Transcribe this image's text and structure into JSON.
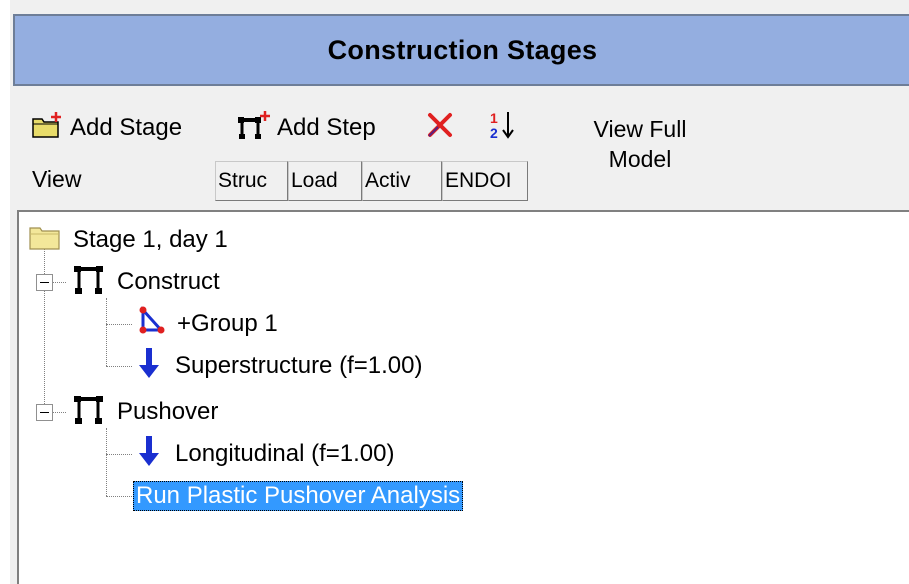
{
  "panel": {
    "title": "Construction Stages"
  },
  "toolbar": {
    "add_stage_label": "Add Stage",
    "add_step_label": "Add Step",
    "delete_icon": "red-x-icon",
    "sort_icon": "sort-1-2-icon",
    "view_label": "View",
    "view_full_line1": "View Full",
    "view_full_line2": "Model",
    "columns": [
      "Struc",
      "Load",
      "Activ",
      "ENDOI"
    ]
  },
  "tree": {
    "stage": {
      "label": "Stage 1, day 1",
      "icon": "folder-icon"
    },
    "steps": [
      {
        "label": "Construct",
        "icon": "step-frame-icon",
        "children": [
          {
            "label": "+Group 1",
            "icon": "group-triangle-icon"
          },
          {
            "label": "Superstructure (f=1.00)",
            "icon": "load-arrow-icon"
          }
        ]
      },
      {
        "label": "Pushover",
        "icon": "step-frame-icon",
        "children": [
          {
            "label": "Longitudinal (f=1.00)",
            "icon": "load-arrow-icon"
          },
          {
            "label": "Run Plastic Pushover Analysis",
            "selected": true
          }
        ]
      }
    ]
  },
  "colors": {
    "title_bg": "#94aee0",
    "selection": "#3399ff",
    "load_arrow": "#1a2fd0",
    "accent_red": "#e02020"
  }
}
